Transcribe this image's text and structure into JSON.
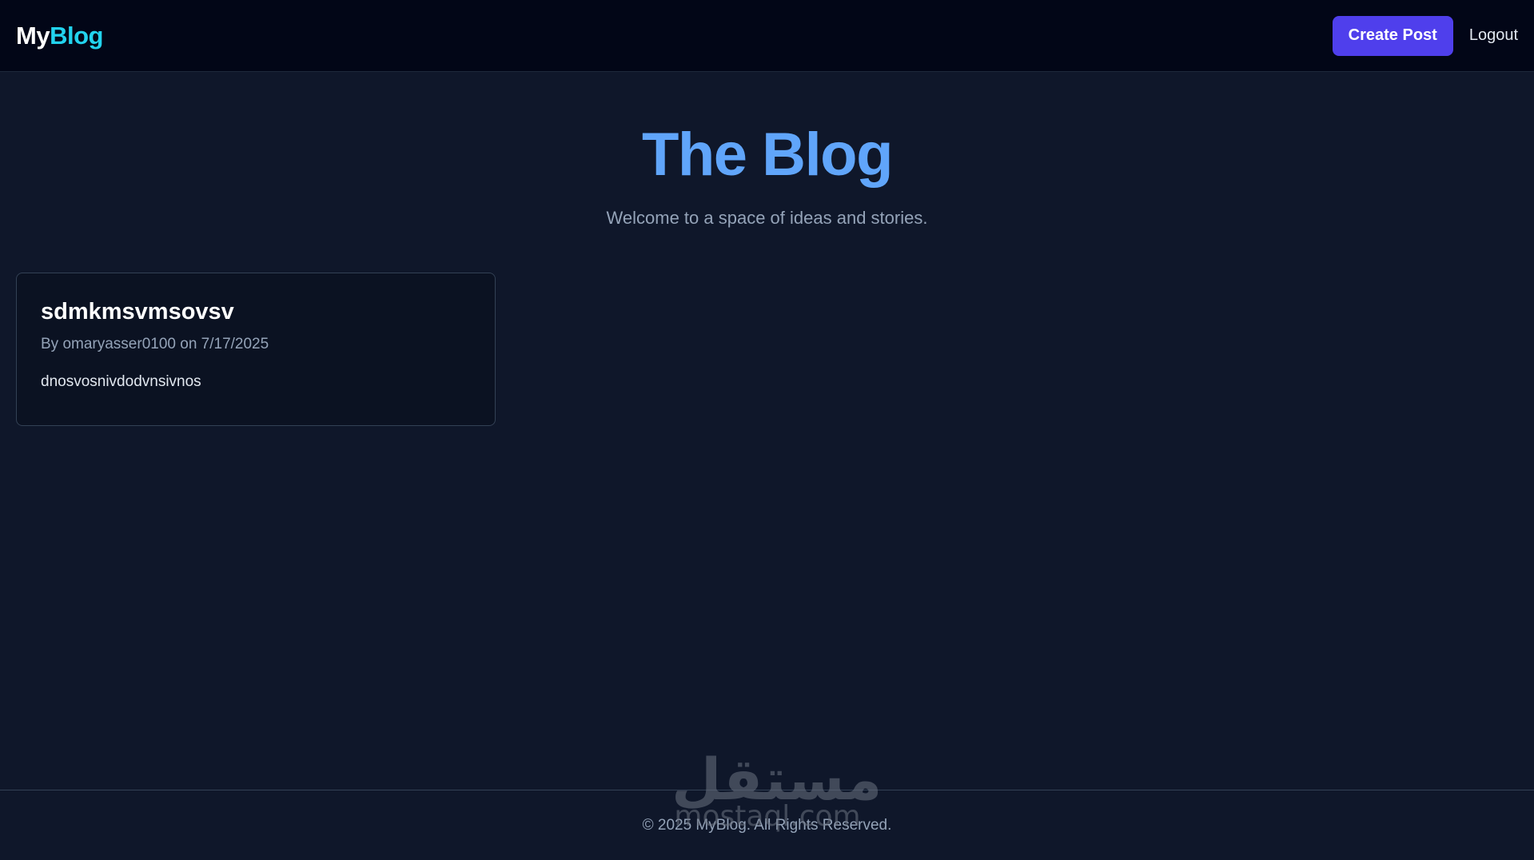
{
  "navbar": {
    "brand_prefix": "My",
    "brand_accent": "Blog",
    "create_label": "Create Post",
    "logout_label": "Logout"
  },
  "hero": {
    "title": "The Blog",
    "subtitle": "Welcome to a space of ideas and stories."
  },
  "posts": [
    {
      "title": "sdmkmsvmsovsv",
      "meta": "By omaryasser0100 on 7/17/2025",
      "body": "dnosvosnivdodvnsivnos"
    }
  ],
  "footer": {
    "text": "© 2025 MyBlog. All Rights Reserved."
  },
  "watermark": {
    "arabic": "مستقل",
    "latin": "mostaql.com"
  },
  "colors": {
    "background": "#0f172a",
    "navbar_bg": "#020617",
    "brand_accent": "#22d3ee",
    "button_bg": "#4f3fec",
    "hero_title": "#60a5fa",
    "muted_text": "#94a3b8",
    "card_border": "#334155"
  }
}
